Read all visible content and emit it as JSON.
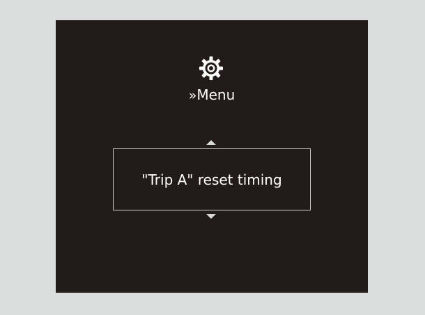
{
  "header": {
    "icon": "gear-icon",
    "breadcrumb_prefix": "»",
    "breadcrumb_label": "Menu"
  },
  "menu": {
    "current_item": "\"Trip A\" reset timing",
    "scroll_up_icon": "triangle-up-icon",
    "scroll_down_icon": "triangle-down-icon"
  },
  "colors": {
    "page_background": "#dcdedd",
    "screen_background": "#231b1a",
    "text": "#ffffff",
    "border": "#d4d4d4"
  }
}
